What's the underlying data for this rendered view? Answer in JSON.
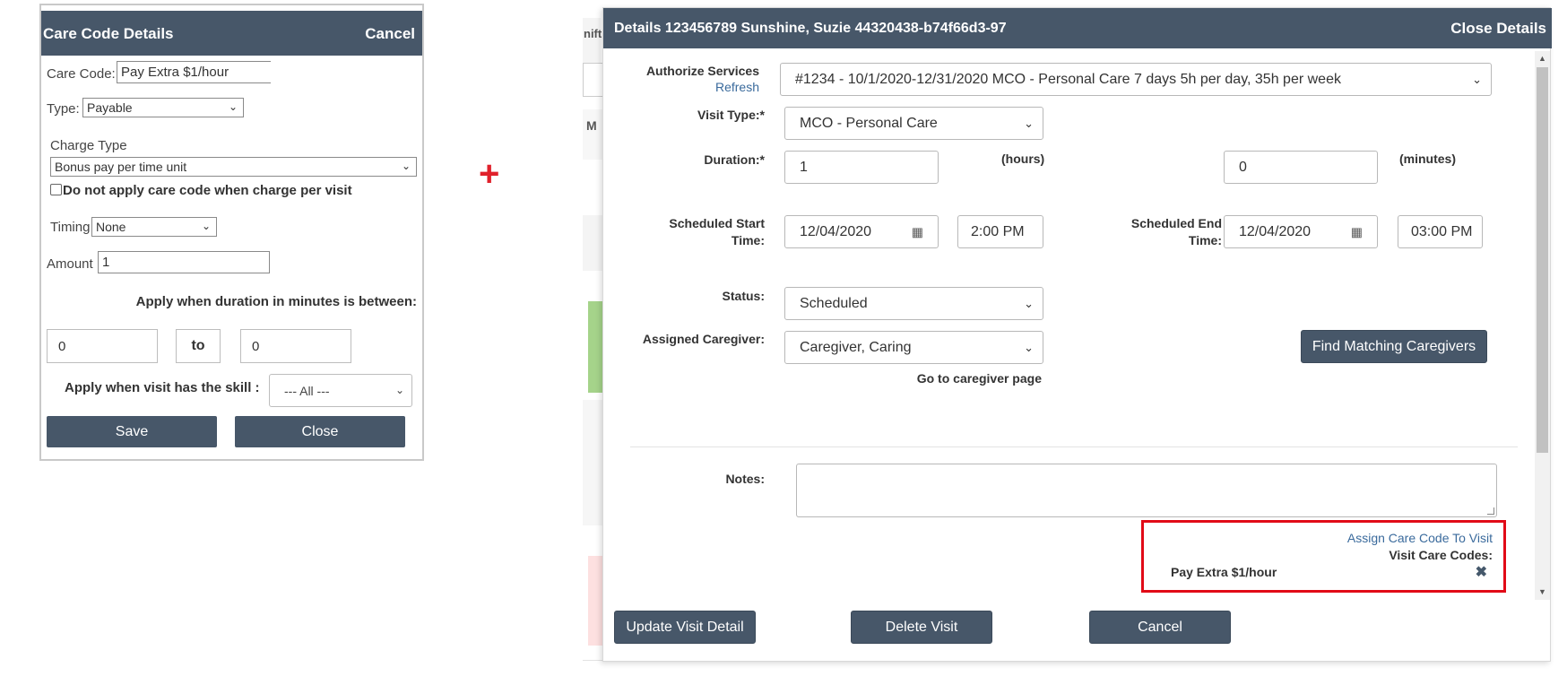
{
  "care_panel": {
    "title": "Care Code Details",
    "cancel_label": "Cancel",
    "care_code_label": "Care Code:",
    "care_code_value": "Pay Extra $1/hour",
    "type_label": "Type:",
    "type_value": "Payable",
    "charge_type_label": "Charge Type",
    "charge_type_value": "Bonus pay per time unit",
    "no_apply_label": "Do not apply care code when charge per visit",
    "timing_label": "Timing",
    "timing_value": "None",
    "amount_label": "Amount",
    "amount_value": "1",
    "duration_label": "Apply when duration in minutes is between:",
    "min_value": "0",
    "to_label": "to",
    "max_value": "0",
    "skill_label": "Apply when visit has the skill :",
    "skill_value": "--- All ---",
    "save_label": "Save",
    "close_label": "Close"
  },
  "plus_sign": "+",
  "background": {
    "frag_1": "nift",
    "frag_2": "M"
  },
  "modal": {
    "title": "Details 123456789 Sunshine, Suzie 44320438-b74f66d3-97",
    "close_label": "Close Details",
    "authorize_label": "Authorize Services",
    "refresh_label": "Refresh",
    "authorize_value": "#1234 - 10/1/2020-12/31/2020 MCO - Personal Care 7 days 5h per day, 35h per week",
    "visit_type_label": "Visit Type:*",
    "visit_type_value": "MCO - Personal Care",
    "duration_label": "Duration:*",
    "duration_hours": "1",
    "hours_unit": "(hours)",
    "duration_minutes": "0",
    "minutes_unit": "(minutes)",
    "sched_start_label_1": "Scheduled Start",
    "sched_start_label_2": "Time:",
    "start_date": "12/04/2020",
    "start_time": "2:00 PM",
    "sched_end_label_1": "Scheduled End",
    "sched_end_label_2": "Time:",
    "end_date": "12/04/2020",
    "end_time": "03:00 PM",
    "status_label": "Status:",
    "status_value": "Scheduled",
    "caregiver_label": "Assigned Caregiver:",
    "caregiver_value": "Caregiver, Caring",
    "goto_caregiver": "Go to caregiver page",
    "find_matching_label": "Find Matching Caregivers",
    "notes_label": "Notes:",
    "notes_value": "",
    "assign_care_code": "Assign Care Code To Visit",
    "visit_care_codes_label": "Visit Care Codes:",
    "care_code_item": "Pay Extra $1/hour",
    "remove_icon": "remove-x-icon",
    "update_label": "Update Visit Detail",
    "delete_label": "Delete Visit",
    "cancel_label": "Cancel"
  },
  "colors": {
    "header_bg": "#475769",
    "highlight": "#e10b17",
    "plus": "#e0212b"
  }
}
